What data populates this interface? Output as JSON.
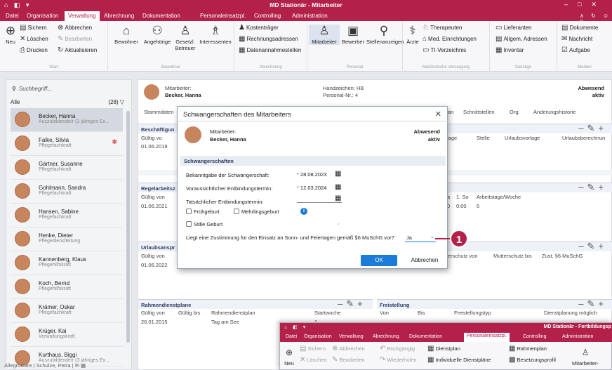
{
  "window": {
    "title": "MD Stationär - Mitarbeiter"
  },
  "menu": {
    "items": [
      "Datei",
      "Organisation",
      "Verwaltung",
      "Abrechnung",
      "Dokumentation",
      "Personaleinsatzpl.",
      "Controlling",
      "Administration"
    ],
    "active": "Verwaltung"
  },
  "ribbon": {
    "start": {
      "neu": "Neu",
      "sichern": "Sichern",
      "abbrechen": "Abbrechen",
      "loeschen": "Löschen",
      "bearbeiten": "Bearbeiten",
      "drucken": "Drucken",
      "aktualisieren": "Aktualisieren",
      "label": "Start"
    },
    "bewohner": {
      "bewohner": "Bewohner",
      "angehoerige": "Angehörige",
      "betreuer": "Gesetzl. Betreuer",
      "interessenten": "Interessenten",
      "label": "Bewohner"
    },
    "abrechnung": {
      "kostentraeger": "Kostenträger",
      "rechnungsadressen": "Rechnungsadressen",
      "datenannahme": "Datenannahmestellen",
      "label": "Abrechnung"
    },
    "personal": {
      "mitarbeiter": "Mitarbeiter",
      "bewerber": "Bewerber",
      "stellenanzeigen": "Stellenanzeigen",
      "label": "Personal"
    },
    "med": {
      "aerzte": "Ärzte",
      "therapeuten": "Therapeuten",
      "einrichtungen": "Med. Einrichtungen",
      "ti": "TI-Verzeichnis",
      "label": "Medizinische Versorgung"
    },
    "sonstige": {
      "lieferanten": "Lieferanten",
      "adressen": "Allgem. Adressen",
      "inventar": "Inventar",
      "label": "Sonstige"
    },
    "medien": {
      "dokumente": "Dokumente",
      "nachricht": "Nachricht",
      "aufgabe": "Aufgabe",
      "label": "Medien"
    }
  },
  "sidebar": {
    "search_placeholder": "Suchbegriff...",
    "filter": "Alle",
    "count": "(28)",
    "employees": [
      {
        "name": "Becker, Hanna",
        "role": "Auszubildende/r (3 jähriges Ex..."
      },
      {
        "name": "Falke, Silvia",
        "role": "Pflegefachkraft"
      },
      {
        "name": "Gärtner, Susanne",
        "role": "Pflegefachkraft"
      },
      {
        "name": "Gohlmann, Sandra",
        "role": "Pflegefachkraft"
      },
      {
        "name": "Hansen, Sabine",
        "role": "Pflegefachkraft"
      },
      {
        "name": "Henke, Dieter",
        "role": "Pflegedienstleitung"
      },
      {
        "name": "Kannenberg, Klaus",
        "role": "Pflegehilfskraft"
      },
      {
        "name": "Koch, Bernd",
        "role": "Pflegehilfskraft"
      },
      {
        "name": "Krämer, Oskar",
        "role": "Pflegefachkraft"
      },
      {
        "name": "Krüger, Kai",
        "role": "Verwaltungskraft"
      },
      {
        "name": "Kurthaus, Biggi",
        "role": "Auszubildende/r (3 jähriges Ex..."
      }
    ],
    "status": "AllegroCare | Schulze, Petra"
  },
  "main": {
    "header": {
      "label": "Mitarbeiter:",
      "name": "Becker, Hanna",
      "hz_label": "Handzeichen:",
      "hz": "HB",
      "pn_label": "Personal-Nr.:",
      "pn": "4",
      "status1": "Abwesend",
      "status2": "aktiv"
    },
    "tabs": [
      "Stammdaten",
      "an",
      "Schnittstellen",
      "Org.",
      "Änderungshistorie"
    ],
    "beschaeftigung": {
      "title": "Beschäftigun",
      "gueltig": "Gültig vo",
      "date": "01.06.2019",
      "cols": [
        "lage",
        "Stelle",
        "Urlaubsvorlage",
        "Urlaubsberechnun"
      ]
    },
    "regelarbeit": {
      "title": "Regelarbeitsz",
      "gueltig": "Gültig von",
      "date": "01.06.2021",
      "cols": [
        "a",
        "1. So",
        "Arbeitstage/Woche"
      ],
      "row": [
        "0",
        "0:00",
        "5"
      ]
    },
    "urlaub": {
      "title": "Urlaubsanspr",
      "gueltig": "Gültig von",
      "date": "01.06.2022",
      "cols": [
        "erschutz von",
        "Mutterschutz bis",
        "Zust. §6 MuSchG"
      ]
    },
    "rahmen": {
      "title": "Rahmendienstplane",
      "cols": [
        "Gültig von",
        "Gültig bis",
        "Rahmendienstplan",
        "Startwoche"
      ],
      "row": [
        "26.01.2015",
        "",
        "Tag am See",
        "1"
      ]
    },
    "freistellung": {
      "title": "Freistellung",
      "cols": [
        "Von",
        "Bis",
        "Freistellungstyp",
        "Dienstplanung möglich"
      ]
    }
  },
  "dialog": {
    "title": "Schwangerschaften des Mitarbeiters",
    "emp_label": "Mitarbeiter:",
    "emp_name": "Becker, Hanna",
    "status1": "Abwesend",
    "status2": "aktiv",
    "section": "Schwangerschaften",
    "f1_label": "Bekanntgabe der Schwangerschaft:",
    "f1_value": "28.08.2023",
    "f2_label": "Voraussichtlicher Entbindungstermin:",
    "f2_value": "12.03.2024",
    "f3_label": "Tatsächlicher Entbindungstermin:",
    "f3_value": "",
    "cb_frueh": "Frühgeburt",
    "cb_mehr": "Mehrlingsgeburt",
    "cb_still": "Stille Geburt",
    "question": "Liegt eine Zustimmung für den Einsatz an Sonn- und Feiertagen gemäß §6 MuSchG vor?",
    "answer": "Ja",
    "ok": "OK",
    "cancel": "Abbrechen"
  },
  "callout": "1",
  "window2": {
    "title": "MD Stationär - Fortbildungsp",
    "menu": [
      "Datei",
      "Organisation",
      "Verwaltung",
      "Abrechnung",
      "Dokumentation",
      "Personaleinsatzpl.",
      "Controlling",
      "Administration"
    ],
    "sichern": "Sichern",
    "abbrechen": "Abbrechen",
    "rueck": "Rückgängig",
    "dienstplan": "Dienstplan",
    "rahmenplan": "Rahmenplan",
    "loeschen": "Löschen",
    "bearbeiten": "Bearbeiten",
    "wieder": "Wiederholen",
    "indiv": "Individuelle Dienstpläne",
    "besetzung": "Besetzungsprofil",
    "neu": "Neu",
    "mitarbeiter": "Mitarbeiter-"
  }
}
